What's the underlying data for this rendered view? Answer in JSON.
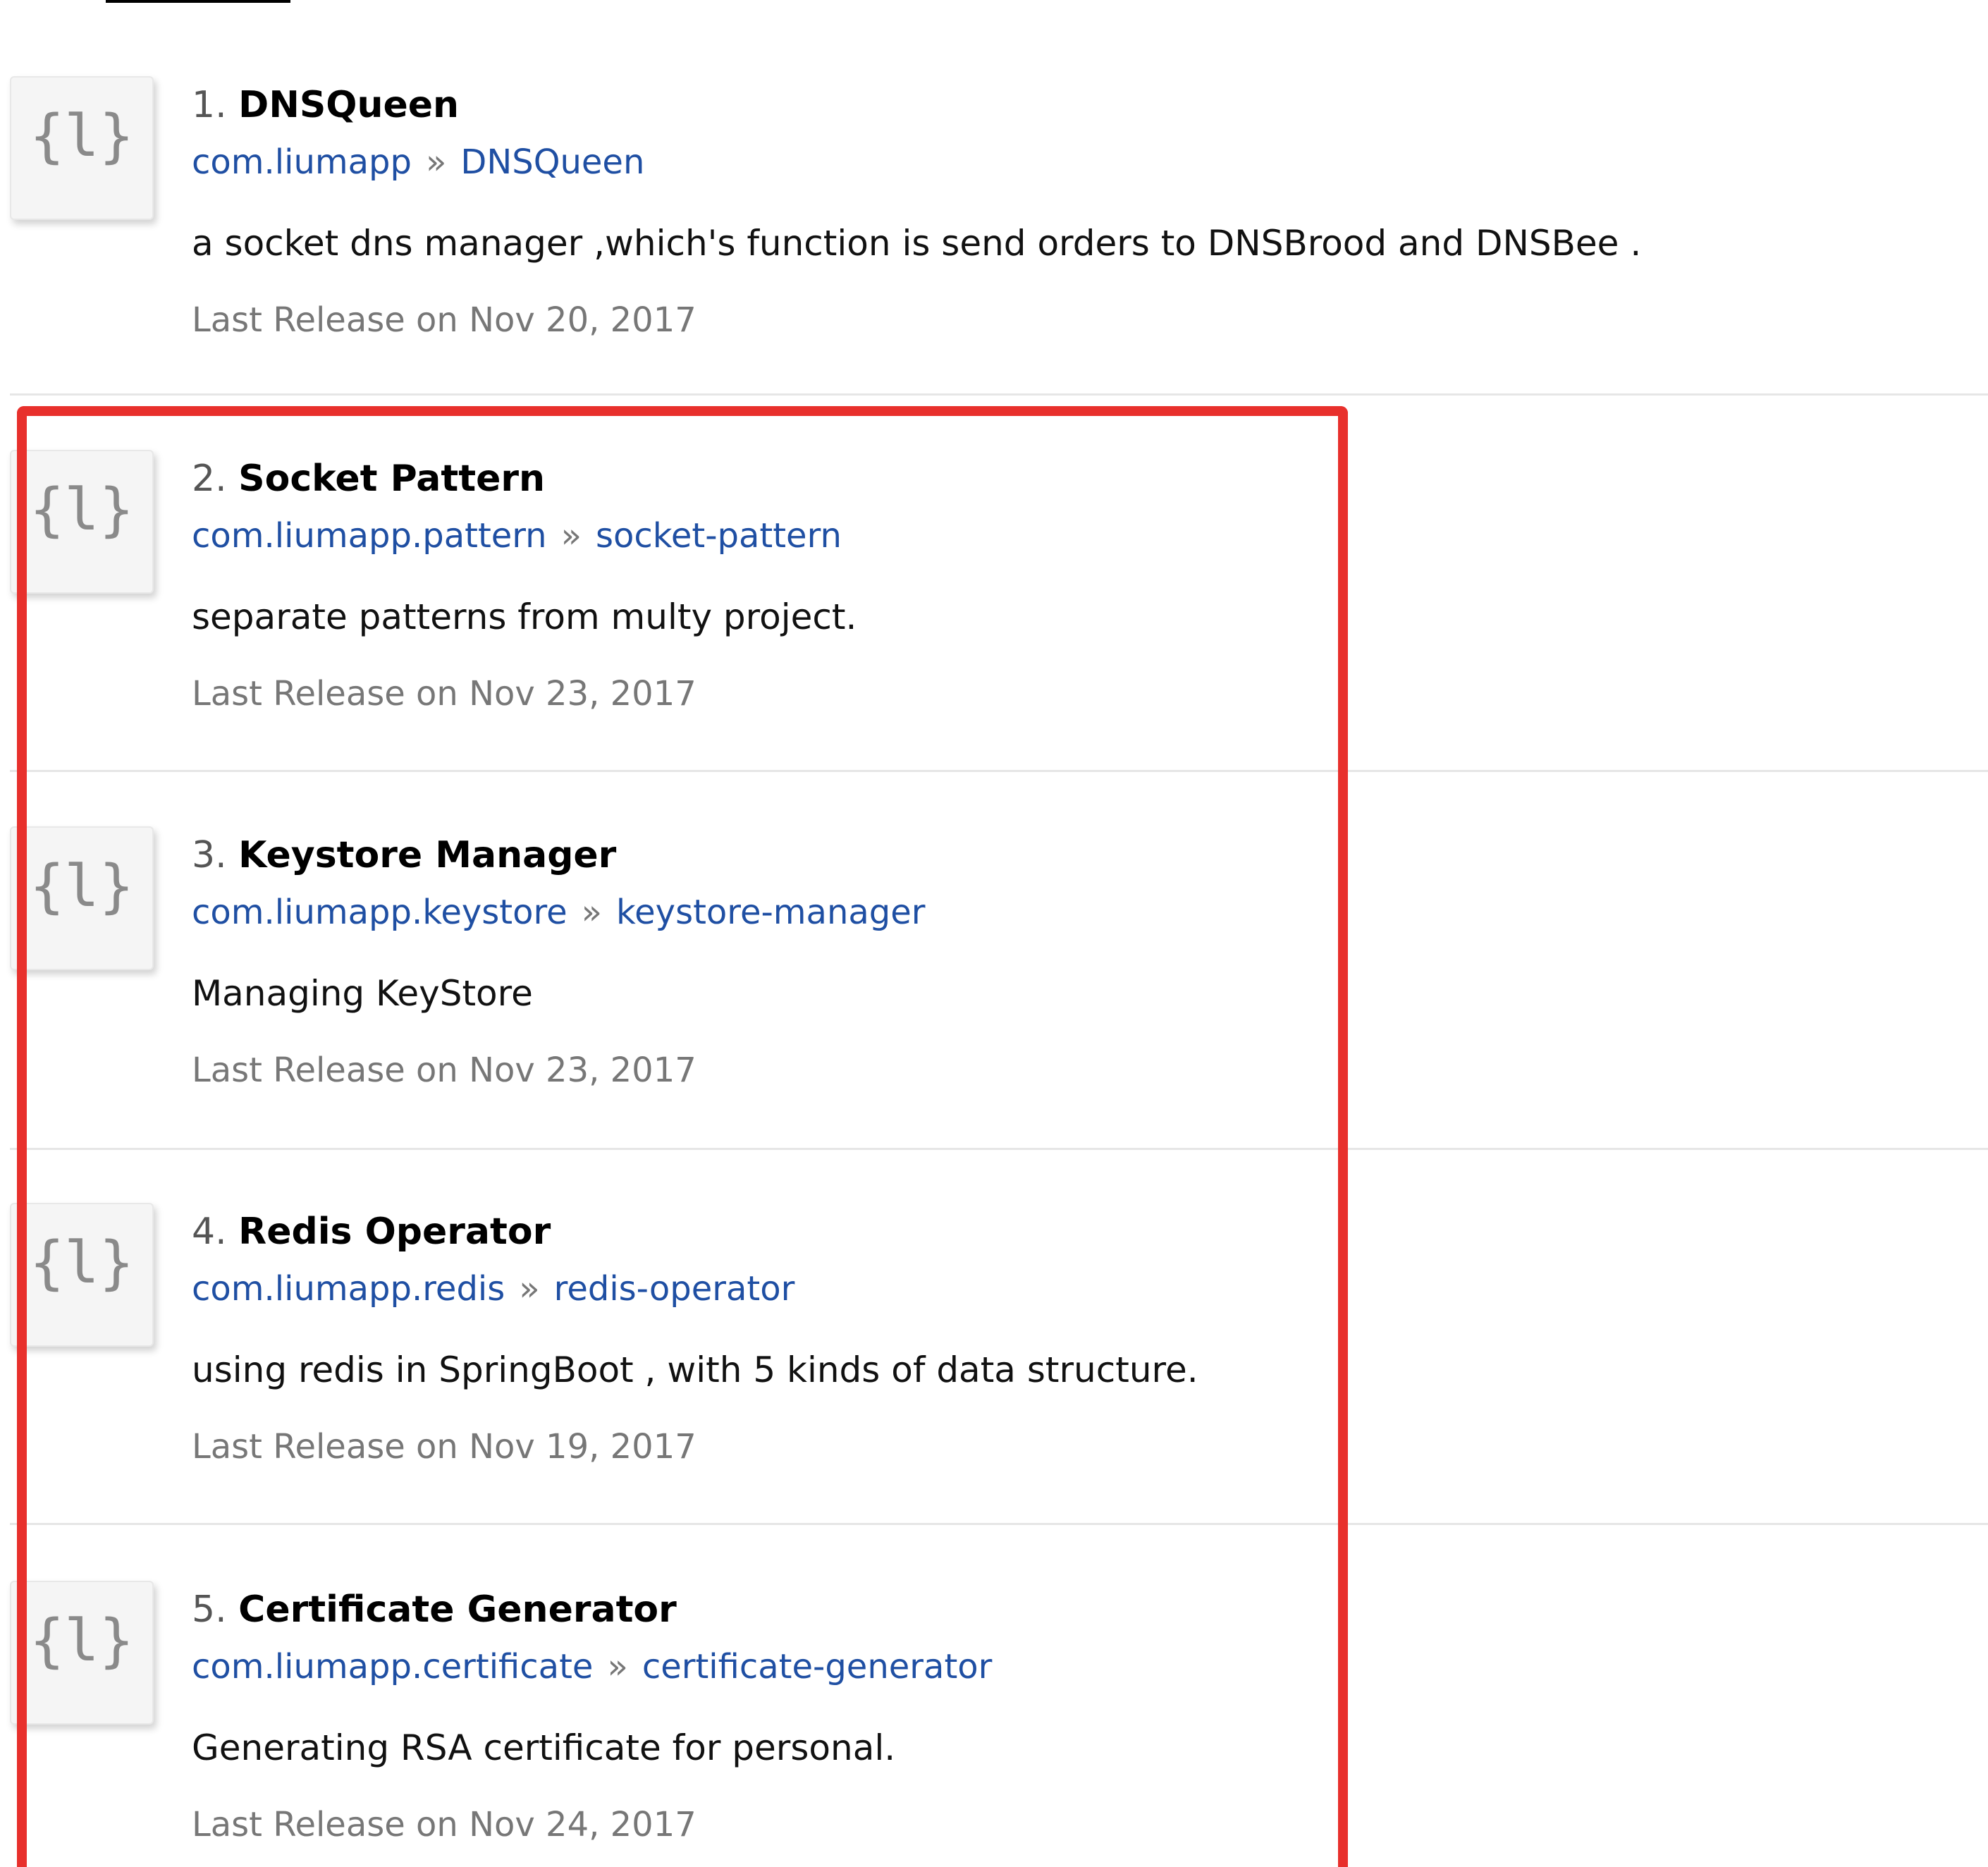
{
  "results": [
    {
      "index": "1.",
      "title": "DNSQueen",
      "group": "com.liumapp",
      "separator": "»",
      "artifact": "DNSQueen",
      "description": "a socket dns manager ,which's function is send orders to DNSBrood and DNSBee .",
      "last_release": "Last Release on Nov 20, 2017",
      "icon_glyph": "{l}",
      "icon": "library-placeholder-icon"
    },
    {
      "index": "2.",
      "title": "Socket Pattern",
      "group": "com.liumapp.pattern",
      "separator": "»",
      "artifact": "socket-pattern",
      "description": "separate patterns from multy project.",
      "last_release": "Last Release on Nov 23, 2017",
      "icon_glyph": "{l}",
      "icon": "library-placeholder-icon"
    },
    {
      "index": "3.",
      "title": "Keystore Manager",
      "group": "com.liumapp.keystore",
      "separator": "»",
      "artifact": "keystore-manager",
      "description": "Managing KeyStore",
      "last_release": "Last Release on Nov 23, 2017",
      "icon_glyph": "{l}",
      "icon": "library-placeholder-icon"
    },
    {
      "index": "4.",
      "title": "Redis Operator",
      "group": "com.liumapp.redis",
      "separator": "»",
      "artifact": "redis-operator",
      "description": "using redis in SpringBoot , with 5 kinds of data structure.",
      "last_release": "Last Release on Nov 19, 2017",
      "icon_glyph": "{l}",
      "icon": "library-placeholder-icon"
    },
    {
      "index": "5.",
      "title": "Certificate Generator",
      "group": "com.liumapp.certificate",
      "separator": "»",
      "artifact": "certificate-generator",
      "description": "Generating RSA certificate for personal.",
      "last_release": "Last Release on Nov 24, 2017",
      "icon_glyph": "{l}",
      "icon": "library-placeholder-icon"
    }
  ],
  "colors": {
    "link": "#1f4fa3",
    "highlight": "#e8302c",
    "muted": "#777777"
  }
}
